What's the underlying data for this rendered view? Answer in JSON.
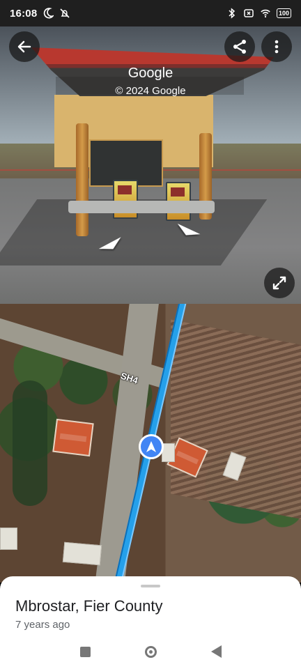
{
  "status_bar": {
    "time": "16:08",
    "left_icons": [
      "moon-icon",
      "notifications-off-icon"
    ],
    "right_icons": [
      "bluetooth-icon",
      "close-box-icon",
      "wifi-icon",
      "battery-icon"
    ],
    "battery": "100"
  },
  "street_view": {
    "title": "Google",
    "copyright": "© 2024 Google",
    "back_icon": "arrow-left-icon",
    "share_icon": "share-icon",
    "more_icon": "more-vertical-icon",
    "expand_icon": "expand-icon",
    "navigation_icons": [
      "left-arrow-icon",
      "right-arrow-icon"
    ]
  },
  "map": {
    "road_label": "SH4",
    "location_icon": "navigation-arrow-icon",
    "colors": {
      "route": "#25a0ea",
      "location": "#4285f4"
    }
  },
  "bottom_sheet": {
    "place_name": "Mbrostar, Fier County",
    "date": "7 years ago"
  },
  "android_navigation": {
    "buttons": [
      "recents-button",
      "home-button",
      "back-button"
    ]
  }
}
